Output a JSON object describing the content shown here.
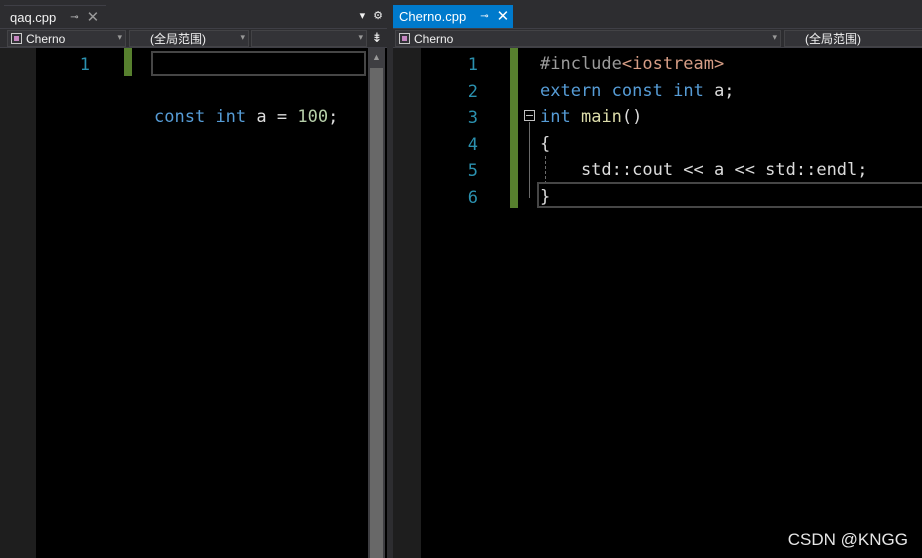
{
  "left_pane": {
    "tab": {
      "filename": "qaq.cpp",
      "pin_glyph": "⊸",
      "close_glyph": "✕"
    },
    "tab_tools": {
      "dropdown_glyph": "▾",
      "settings_glyph": "⚙"
    },
    "nav": {
      "project": "Cherno",
      "scope": "(全局范围)",
      "member": "",
      "arrow_glyph": "▾",
      "split_glyph": "⇟"
    },
    "line_numbers": [
      "1"
    ],
    "code": "const int a = 100;"
  },
  "right_pane": {
    "tab": {
      "filename": "Cherno.cpp",
      "pin_glyph": "⊸",
      "close_glyph": "✕"
    },
    "nav": {
      "project": "Cherno",
      "scope": "(全局范围)",
      "arrow_glyph": "▾"
    },
    "line_numbers": [
      "1",
      "2",
      "3",
      "4",
      "5",
      "6"
    ],
    "code_lines": [
      "#include<iostream>",
      "extern const int a;",
      "int main()",
      "{",
      "    std::cout << a << std::endl;",
      "}"
    ]
  },
  "watermark": "CSDN @KNGG",
  "colors": {
    "active_tab": "#007acc",
    "keyword": "#569cd6",
    "number": "#b5cea8",
    "line_number": "#2b91af",
    "change_bar": "#57802e"
  }
}
